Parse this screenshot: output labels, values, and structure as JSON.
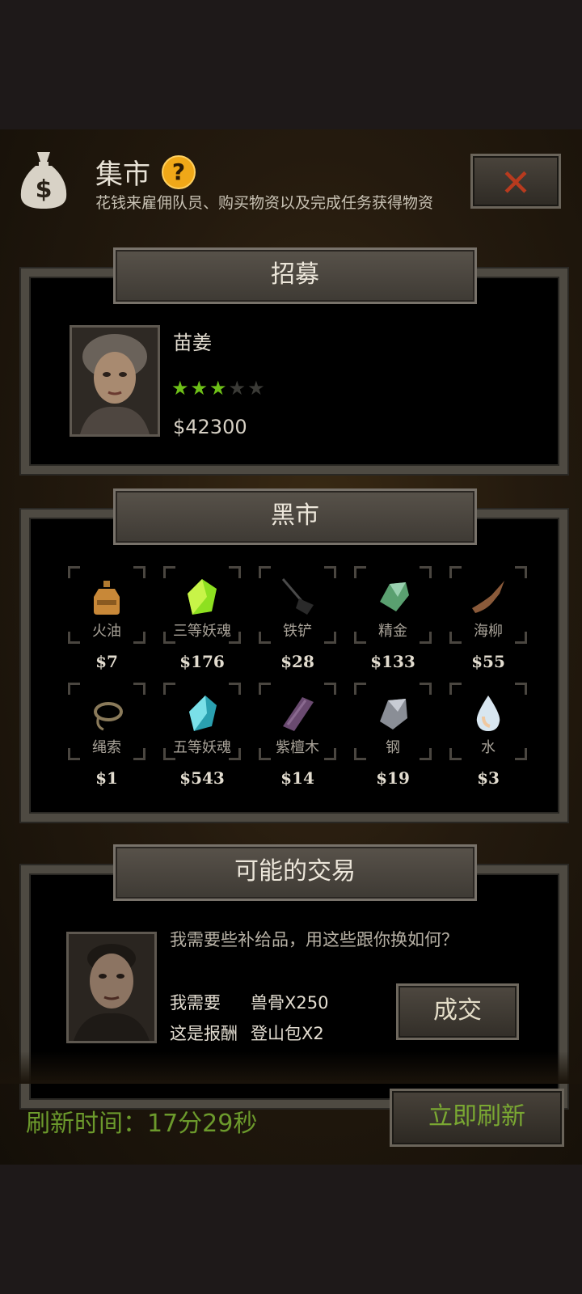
{
  "header": {
    "title": "集市",
    "help": "?",
    "subtitle": "花钱来雇佣队员、购买物资以及完成任务获得物资",
    "close": "✕"
  },
  "recruit": {
    "section_title": "招募",
    "name": "苗姜",
    "stars_filled": 3,
    "stars_total": 5,
    "price": "$42300"
  },
  "market": {
    "section_title": "黑市",
    "items": [
      {
        "name": "火油",
        "price": "$7",
        "icon": "oil-bottle-icon"
      },
      {
        "name": "三等妖魂",
        "price": "$176",
        "icon": "green-crystal-icon"
      },
      {
        "name": "铁铲",
        "price": "$28",
        "icon": "shovel-icon"
      },
      {
        "name": "精金",
        "price": "$133",
        "icon": "ore-icon"
      },
      {
        "name": "海柳",
        "price": "$55",
        "icon": "driftwood-icon"
      },
      {
        "name": "绳索",
        "price": "$1",
        "icon": "rope-icon"
      },
      {
        "name": "五等妖魂",
        "price": "$543",
        "icon": "blue-crystal-icon"
      },
      {
        "name": "紫檀木",
        "price": "$14",
        "icon": "purple-wood-icon"
      },
      {
        "name": "钢",
        "price": "$19",
        "icon": "steel-icon"
      },
      {
        "name": "水",
        "price": "$3",
        "icon": "water-drop-icon"
      }
    ]
  },
  "trade": {
    "section_title": "可能的交易",
    "message": "我需要些补给品，用这些跟你换如何？",
    "need_label": "我需要",
    "need_item": "兽骨X250",
    "reward_label": "这是报酬",
    "reward_item": "登山包X2",
    "deal_button": "成交"
  },
  "footer": {
    "refresh_time": "刷新时间：17分29秒",
    "refresh_button": "立即刷新"
  },
  "colors": {
    "accent_green": "#6c9a2c",
    "star_green": "#6ec018",
    "close_red": "#b83a1e",
    "help_orange": "#f0a818"
  }
}
